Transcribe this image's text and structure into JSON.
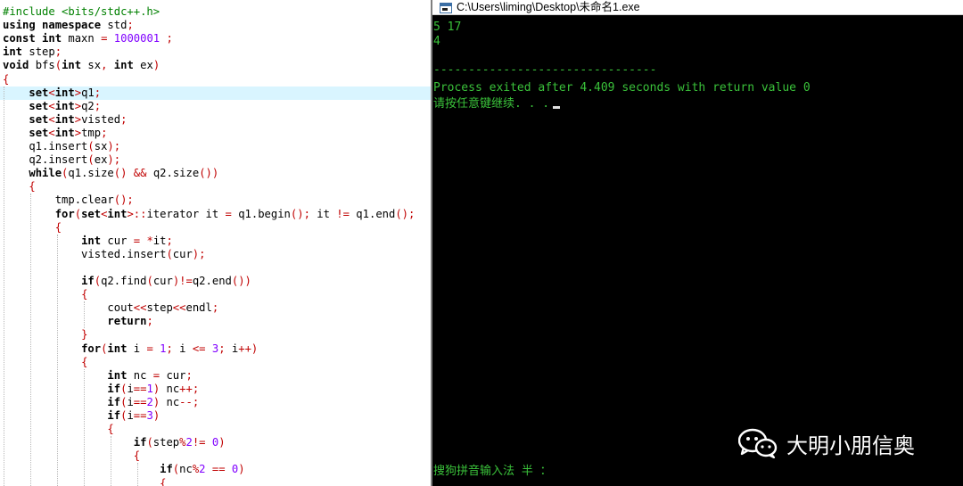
{
  "editor": {
    "lines": [
      "#include <bits/stdc++.h>",
      "using namespace std;",
      "const int maxn = 1000001 ;",
      "int step;",
      "void bfs(int sx, int ex)",
      "{",
      "    set<int>q1;",
      "    set<int>q2;",
      "    set<int>visted;",
      "    set<int>tmp;",
      "    q1.insert(sx);",
      "    q2.insert(ex);",
      "    while(q1.size() && q2.size())",
      "    {",
      "        tmp.clear();",
      "        for(set<int>::iterator it = q1.begin(); it != q1.end();",
      "        {",
      "            int cur = *it;",
      "            visted.insert(cur);",
      "",
      "            if(q2.find(cur)!=q2.end())",
      "            {",
      "                cout<<step<<endl;",
      "                return;",
      "            }",
      "            for(int i = 1; i <= 3; i++)",
      "            {",
      "                int nc = cur;",
      "                if(i==1) nc++;",
      "                if(i==2) nc--;",
      "                if(i==3)",
      "                {",
      "                    if(step%2!= 0)",
      "                    {",
      "                        if(nc%2 == 0)",
      "                        {"
    ]
  },
  "console": {
    "title": "C:\\Users\\liming\\Desktop\\未命名1.exe",
    "lines": [
      "5 17",
      "4",
      "",
      "--------------------------------",
      "Process exited after 4.409 seconds with return value 0",
      "请按任意键继续. . ."
    ],
    "ime_status": "搜狗拼音输入法 半 ："
  },
  "watermark": {
    "text": "大明小朋信奥",
    "icon": "wechat-icon"
  },
  "colors": {
    "console_text": "#3ac13a",
    "current_line": "#d9f5ff",
    "preprocessor": "#008000",
    "number": "#8000ff",
    "operator": "#c00000"
  }
}
